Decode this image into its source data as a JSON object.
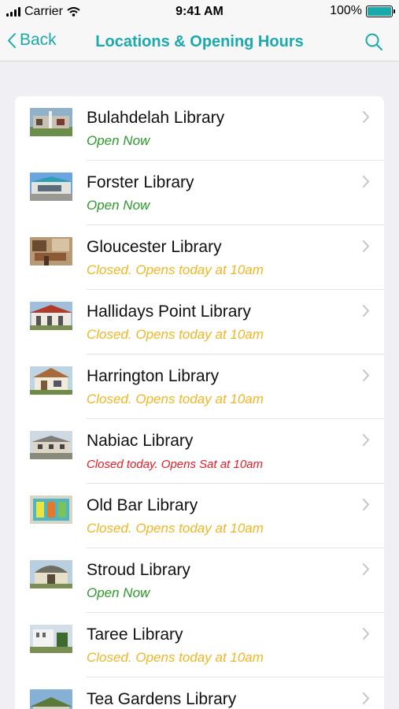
{
  "status_bar": {
    "carrier": "Carrier",
    "time": "9:41 AM",
    "battery": "100%",
    "battery_color": "#1aa9ad"
  },
  "nav": {
    "back_label": "Back",
    "title": "Locations & Opening Hours",
    "accent": "#1aa9ad"
  },
  "status_colors": {
    "open": "#2b9a2b",
    "opens_today": "#f0b623",
    "closed_today": "#e81c25"
  },
  "libraries": [
    {
      "name": "Bulahdelah Library",
      "hours": "Open Now",
      "status": "open"
    },
    {
      "name": "Forster Library",
      "hours": "Open Now",
      "status": "open"
    },
    {
      "name": "Gloucester Library",
      "hours": "Closed. Opens today at 10am",
      "status": "opens-today"
    },
    {
      "name": "Hallidays Point Library",
      "hours": "Closed. Opens today at 10am",
      "status": "opens-today"
    },
    {
      "name": "Harrington Library",
      "hours": "Closed. Opens today at 10am",
      "status": "opens-today"
    },
    {
      "name": "Nabiac Library",
      "hours": "Closed today. Opens Sat at 10am",
      "status": "closed-today"
    },
    {
      "name": "Old Bar Library",
      "hours": "Closed. Opens today at 10am",
      "status": "opens-today"
    },
    {
      "name": "Stroud Library",
      "hours": "Open Now",
      "status": "open"
    },
    {
      "name": "Taree Library",
      "hours": "Closed. Opens today at 10am",
      "status": "opens-today"
    },
    {
      "name": "Tea Gardens Library",
      "hours": "",
      "status": ""
    }
  ]
}
